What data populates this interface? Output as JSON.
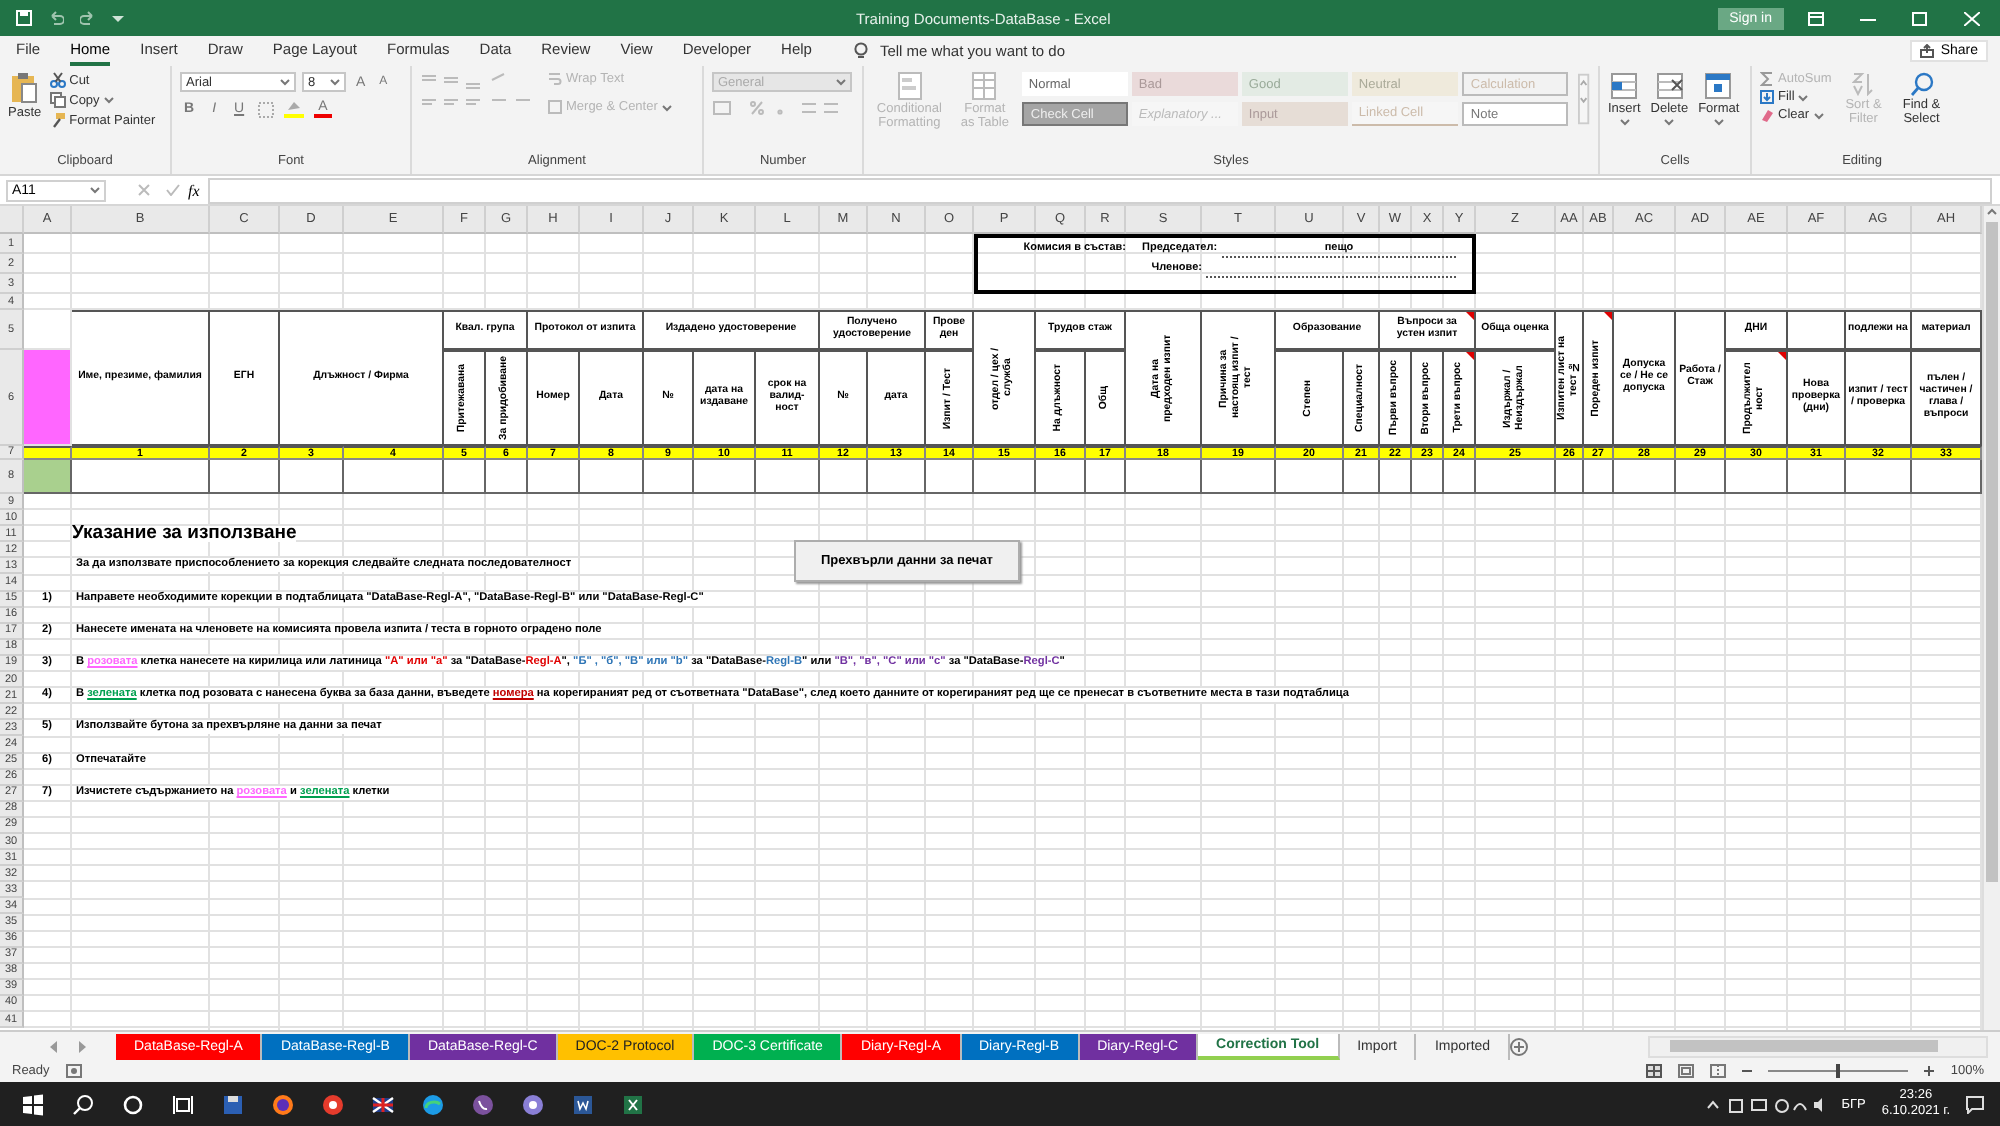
{
  "window": {
    "title": "Training Documents-DataBase  -  Excel",
    "sign_in": "Sign in"
  },
  "menu_tabs": [
    {
      "label": "File",
      "selected": false
    },
    {
      "label": "Home",
      "selected": true
    },
    {
      "label": "Insert",
      "selected": false
    },
    {
      "label": "Draw",
      "selected": false
    },
    {
      "label": "Page Layout",
      "selected": false
    },
    {
      "label": "Formulas",
      "selected": false
    },
    {
      "label": "Data",
      "selected": false
    },
    {
      "label": "Review",
      "selected": false
    },
    {
      "label": "View",
      "selected": false
    },
    {
      "label": "Developer",
      "selected": false
    },
    {
      "label": "Help",
      "selected": false
    }
  ],
  "tell_me": "Tell me what you want to do",
  "share": "Share",
  "ribbon": {
    "clipboard": {
      "label": "Clipboard",
      "paste": "Paste",
      "cut": "Cut",
      "copy": "Copy",
      "format_painter": "Format Painter"
    },
    "font": {
      "label": "Font",
      "name": "Arial",
      "size": "8",
      "grow": "A",
      "shrink": "A",
      "format_buttons": [
        {
          "label": "B",
          "kind": "bold"
        },
        {
          "label": "I",
          "kind": "italic"
        },
        {
          "label": "U",
          "kind": "underline"
        }
      ],
      "font_color": "A"
    },
    "alignment": {
      "label": "Alignment",
      "disabled": true,
      "wrap_text": "Wrap Text",
      "merge": "Merge & Center"
    },
    "number": {
      "label": "Number",
      "disabled": true,
      "format": "General"
    },
    "styles": {
      "label": "Styles",
      "disabled": true,
      "conditional": "Conditional Formatting",
      "format_as_table": "Format as Table",
      "cell_styles": [
        {
          "label": "Normal",
          "kind": "normal"
        },
        {
          "label": "Bad",
          "kind": "bad"
        },
        {
          "label": "Good",
          "kind": "good"
        },
        {
          "label": "Neutral",
          "kind": "neutral"
        },
        {
          "label": "Calculation",
          "kind": "calculation"
        },
        {
          "label": "Check Cell",
          "kind": "check"
        },
        {
          "label": "Explanatory ...",
          "kind": "explanatory"
        },
        {
          "label": "Input",
          "kind": "input"
        },
        {
          "label": "Linked Cell",
          "kind": "linked"
        },
        {
          "label": "Note",
          "kind": "note"
        }
      ]
    },
    "cells": {
      "label": "Cells",
      "buttons": [
        {
          "label": "Insert",
          "kind": "insert"
        },
        {
          "label": "Delete",
          "kind": "delete"
        },
        {
          "label": "Format",
          "kind": "format"
        }
      ]
    },
    "editing": {
      "label": "Editing",
      "autosum": {
        "label": "AutoSum",
        "disabled": true
      },
      "fill": {
        "label": "Fill",
        "disabled": false
      },
      "clear": {
        "label": "Clear",
        "disabled": false
      },
      "sort": {
        "label": "Sort & Filter",
        "disabled": true
      },
      "find": {
        "label": "Find & Select",
        "disabled": false
      }
    }
  },
  "formula_bar": {
    "name_box": "A11",
    "fx": "fx"
  },
  "sheet": {
    "column_letters": [
      "A",
      "B",
      "C",
      "D",
      "E",
      "F",
      "G",
      "H",
      "I",
      "J",
      "K",
      "L",
      "M",
      "N",
      "O",
      "P",
      "Q",
      "R",
      "S",
      "T",
      "U",
      "V",
      "W",
      "X",
      "Y",
      "Z",
      "AA",
      "AB",
      "AC",
      "AD",
      "AE",
      "AF",
      "AG",
      "AH"
    ],
    "row_numbers": [
      "1",
      "2",
      "3",
      "4",
      "5",
      "6",
      "7",
      "8",
      "9",
      "10",
      "11",
      "12",
      "13",
      "14",
      "15",
      "16",
      "17",
      "18",
      "19",
      "20",
      "21",
      "22",
      "23",
      "24",
      "25",
      "26",
      "27",
      "28",
      "29",
      "30",
      "31",
      "32",
      "33",
      "34",
      "35",
      "36",
      "37",
      "38",
      "39",
      "40",
      "41"
    ],
    "commission": {
      "label": "Комисия в състав:",
      "chair_label": "Председател:",
      "chair": "пещо",
      "members_label": "Членове:"
    },
    "header_cells": [
      {
        "text": "Име, презиме, фамилия",
        "kind": "horizontal",
        "comment": false
      },
      {
        "text": "ЕГН",
        "kind": "horizontal",
        "comment": false
      },
      {
        "text": "Длъжност / Фирма",
        "kind": "horizontal",
        "comment": false
      },
      {
        "text": "Квал. група",
        "kind": "horizontal",
        "comment": false
      },
      {
        "text": "Притежавана",
        "kind": "vertical",
        "comment": false
      },
      {
        "text": "За придобиване",
        "kind": "vertical",
        "comment": false
      },
      {
        "text": "Протокол от изпита",
        "kind": "horizontal",
        "comment": false
      },
      {
        "text": "Номер",
        "kind": "horizontal",
        "comment": false
      },
      {
        "text": "Дата",
        "kind": "horizontal",
        "comment": false
      },
      {
        "text": "Издадено удостоверение",
        "kind": "horizontal",
        "comment": false
      },
      {
        "text": "№",
        "kind": "horizontal",
        "comment": false
      },
      {
        "text": "дата на издаване",
        "kind": "horizontal",
        "comment": false
      },
      {
        "text": "срок на валид-ност",
        "kind": "horizontal",
        "comment": false
      },
      {
        "text": "Получено удостоверение",
        "kind": "horizontal",
        "comment": false
      },
      {
        "text": "№",
        "kind": "horizontal",
        "comment": false
      },
      {
        "text": "дата",
        "kind": "horizontal",
        "comment": false
      },
      {
        "text": "Прове ден",
        "kind": "horizontal",
        "comment": false
      },
      {
        "text": "Изпит / Тест",
        "kind": "vertical",
        "comment": false
      },
      {
        "text": "отдел / цех / служба",
        "kind": "vertical",
        "comment": false
      },
      {
        "text": "Трудов стаж",
        "kind": "horizontal",
        "comment": false
      },
      {
        "text": "На длъжност",
        "kind": "vertical",
        "comment": false
      },
      {
        "text": "Общ",
        "kind": "vertical",
        "comment": false
      },
      {
        "text": "Дата на предходен изпит",
        "kind": "vertical",
        "comment": false
      },
      {
        "text": "Причина за настоящ изпит / тест",
        "kind": "vertical",
        "comment": false
      },
      {
        "text": "Образование",
        "kind": "horizontal",
        "comment": false
      },
      {
        "text": "Степен",
        "kind": "vertical",
        "comment": false
      },
      {
        "text": "Специалност",
        "kind": "vertical",
        "comment": false
      },
      {
        "text": "Въпроси за устен изпит",
        "kind": "horizontal",
        "comment": true
      },
      {
        "text": "Първи въпрос",
        "kind": "vertical",
        "comment": false
      },
      {
        "text": "Втори въпрос",
        "kind": "vertical",
        "comment": false
      },
      {
        "text": "Трети въпрос",
        "kind": "vertical",
        "comment": true
      },
      {
        "text": "Обща оценка",
        "kind": "horizontal",
        "comment": false
      },
      {
        "text": "Издържал / Неиздържал",
        "kind": "vertical",
        "comment": false
      },
      {
        "text": "Изпитен лист на тест №",
        "kind": "vertical",
        "comment": false
      },
      {
        "text": "Пореден изпит",
        "kind": "vertical",
        "comment": true
      },
      {
        "text": "Допуска се / Не се допуска",
        "kind": "horizontal",
        "comment": false
      },
      {
        "text": "Работа / Стаж",
        "kind": "horizontal",
        "comment": false
      },
      {
        "text": "ДНИ",
        "kind": "horizontal",
        "comment": false
      },
      {
        "text": "Продължител ност",
        "kind": "vertical",
        "comment": true
      },
      {
        "text": "Нова проверка (дни)",
        "kind": "horizontal",
        "comment": false
      },
      {
        "text": "подлежи на",
        "kind": "horizontal",
        "comment": false
      },
      {
        "text": "изпит / тест / проверка",
        "kind": "horizontal",
        "comment": false
      },
      {
        "text": "материал",
        "kind": "horizontal",
        "comment": false
      },
      {
        "text": "пълен / частичен / глава / въпроси",
        "kind": "horizontal",
        "comment": false
      }
    ],
    "column_numbers": [
      "1",
      "2",
      "3",
      "4",
      "5",
      "6",
      "7",
      "8",
      "9",
      "10",
      "11",
      "12",
      "13",
      "14",
      "15",
      "16",
      "17",
      "18",
      "19",
      "20",
      "21",
      "22",
      "23",
      "24",
      "25",
      "26",
      "27",
      "28",
      "29",
      "30",
      "31",
      "32",
      "33"
    ],
    "button": "Прехвърли данни за печат",
    "instructions": {
      "title": "Указание за използване",
      "intro": "За да използвате приспособлението за корекция следвайте следната последователност",
      "steps": [
        {
          "number": "1)",
          "segments": [
            {
              "text": "Направете необходимите корекции в подтаблицата \"DataBase-Regl-A\", \"DataBase-Regl-B\" или \"DataBase-Regl-C\"",
              "kind": "plain"
            }
          ]
        },
        {
          "number": "2)",
          "segments": [
            {
              "text": "Нанесете имената на членовете на комисията провела изпита / теста в горното оградено поле",
              "kind": "plain"
            }
          ]
        },
        {
          "number": "3)",
          "segments": [
            {
              "text": "В ",
              "kind": "plain"
            },
            {
              "text": "розовата",
              "kind": "pink_link"
            },
            {
              "text": " клетка нанесете на кирилица или латиница ",
              "kind": "plain"
            },
            {
              "text": "\"А\"  или \"а\"",
              "kind": "red"
            },
            {
              "text": " за  \"DataBase-",
              "kind": "plain"
            },
            {
              "text": "Regl-A",
              "kind": "red"
            },
            {
              "text": "\", ",
              "kind": "plain"
            },
            {
              "text": "\"Б\" , \"б\", \"B\" или \"b\"",
              "kind": "blue"
            },
            {
              "text": " за  \"DataBase-",
              "kind": "plain"
            },
            {
              "text": "Regl-B",
              "kind": "blue"
            },
            {
              "text": "\"  или ",
              "kind": "plain"
            },
            {
              "text": "\"В\",  \"в\", \"C\"  или \"c\"",
              "kind": "purple"
            },
            {
              "text": " за \"DataBase-",
              "kind": "plain"
            },
            {
              "text": "Regl-C",
              "kind": "purple"
            },
            {
              "text": "\"",
              "kind": "plain"
            }
          ]
        },
        {
          "number": "4)",
          "segments": [
            {
              "text": "В ",
              "kind": "plain"
            },
            {
              "text": "зелената",
              "kind": "green_link"
            },
            {
              "text": " клетка под  розовата с нанесена буква за база данни,  въведете ",
              "kind": "plain"
            },
            {
              "text": "номера",
              "kind": "red_link"
            },
            {
              "text": " на корегираният ред от съответната \"DataBase\", след което данните от корегираният ред ще се пренесат в съответните места в тази подтаблица",
              "kind": "plain"
            }
          ]
        },
        {
          "number": "5)",
          "segments": [
            {
              "text": "Използвайте бутона за прехвърляне на данни за печат",
              "kind": "plain"
            }
          ]
        },
        {
          "number": "6)",
          "segments": [
            {
              "text": "Отпечатайте",
              "kind": "plain"
            }
          ]
        },
        {
          "number": "7)",
          "segments": [
            {
              "text": "Изчистете съдържанието на ",
              "kind": "plain"
            },
            {
              "text": "розовата",
              "kind": "pink_link"
            },
            {
              "text": " и ",
              "kind": "plain"
            },
            {
              "text": "зелената",
              "kind": "green_link"
            },
            {
              "text": " клетки",
              "kind": "plain"
            }
          ]
        }
      ]
    }
  },
  "sheet_tabs": [
    {
      "label": "DataBase-Regl-A",
      "color": "#ff0000",
      "selected": false
    },
    {
      "label": "DataBase-Regl-B",
      "color": "#0070c0",
      "selected": false
    },
    {
      "label": "DataBase-Regl-C",
      "color": "#7030a0",
      "selected": false
    },
    {
      "label": "DOC-2 Protocol",
      "color": "#ffc000",
      "selected": false
    },
    {
      "label": "DOC-3 Certificate",
      "color": "#00b050",
      "selected": false
    },
    {
      "label": "Diary-Regl-A",
      "color": "#ff0000",
      "selected": false
    },
    {
      "label": "Diary-Regl-B",
      "color": "#0070c0",
      "selected": false
    },
    {
      "label": "Diary-Regl-C",
      "color": "#7030a0",
      "selected": false
    },
    {
      "label": "Correction Tool",
      "color": "#92d050",
      "selected": true
    },
    {
      "label": "Import",
      "selected": false
    },
    {
      "label": "Imported",
      "selected": false
    }
  ],
  "status_bar": {
    "ready": "Ready",
    "zoom": {
      "reading": "100%",
      "level": 0.5
    }
  },
  "taskbar": {
    "language": "БГР",
    "time": "23:26",
    "date": "6.10.2021 г."
  }
}
